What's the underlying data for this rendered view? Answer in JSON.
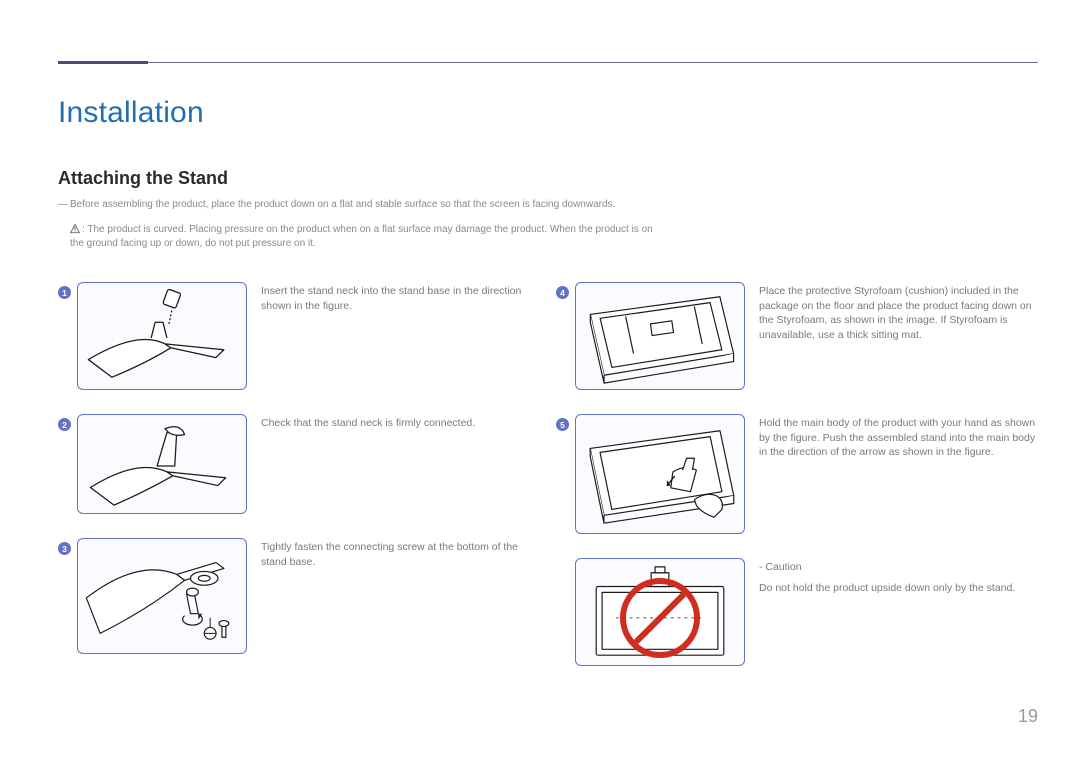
{
  "pageTitle": "Installation",
  "sectionTitle": "Attaching the Stand",
  "intro": {
    "line1": "Before assembling the product, place the product down on a flat and stable surface so that the screen is facing downwards.",
    "warn": ": The product is curved. Placing pressure on the product when on a flat surface may damage the product. When the product is on the ground facing up or down, do not put pressure on it."
  },
  "steps": {
    "s1": {
      "num": "1",
      "text": "Insert the stand neck into the stand base in the direction shown in the figure."
    },
    "s2": {
      "num": "2",
      "text": "Check that the stand neck is firmly connected."
    },
    "s3": {
      "num": "3",
      "text": "Tightly fasten the connecting screw at the bottom of the stand base."
    },
    "s4": {
      "num": "4",
      "text": "Place the protective Styrofoam (cushion) included in the package on the floor and place the product facing down on the Styrofoam, as shown in the image. If Styrofoam is unavailable, use a thick sitting mat."
    },
    "s5": {
      "num": "5",
      "text": "Hold the main body of the product with your hand as shown by the figure. Push the assembled stand into the main body in the direction of the arrow as shown in the figure."
    },
    "caution": {
      "title": "- Caution",
      "text": "Do not hold the product upside down only by the stand."
    }
  },
  "pageNumber": "19"
}
